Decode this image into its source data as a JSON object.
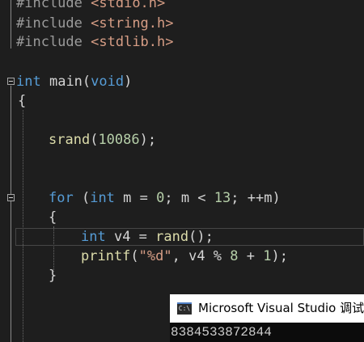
{
  "editor": {
    "lines": {
      "l1": {
        "directive": "#include",
        "header": "<stdio.h>"
      },
      "l2": {
        "directive": "#include",
        "header": "<string.h>"
      },
      "l3": {
        "directive": "#include",
        "header": "<stdlib.h>"
      },
      "l4": {
        "ret_type": "int",
        "fn_name": "main",
        "open": "(",
        "param": "void",
        "close": ")"
      },
      "l5": {
        "text": "{"
      },
      "l6": {
        "fn_name": "srand",
        "open": "(",
        "num": "10086",
        "close": ");"
      },
      "l7": {
        "kw": "for",
        "p1": " (",
        "type": "int",
        "p2": " m = ",
        "n1": "0",
        "p3": "; m < ",
        "n2": "13",
        "p4": "; ++m)"
      },
      "l8": {
        "text": "{"
      },
      "l9": {
        "type": "int",
        "p1": " v4 = ",
        "fn_name": "rand",
        "p2": "();"
      },
      "l10": {
        "fn_name": "printf",
        "p1": "(",
        "str": "\"%d\"",
        "p2": ", v4 % ",
        "n1": "8",
        "p3": " + ",
        "n2": "1",
        "p4": ");"
      },
      "l11": {
        "text": "}"
      }
    }
  },
  "console": {
    "icon": "console-app-icon",
    "icon_text": "C:\\",
    "title": "Microsoft Visual Studio 调试控制台",
    "output": "8384533872844"
  },
  "colors": {
    "background": "#1e1e1e",
    "keyword": "#569cd6",
    "function": "#dcdcaa",
    "number": "#b5cea8",
    "string": "#d69d85"
  }
}
